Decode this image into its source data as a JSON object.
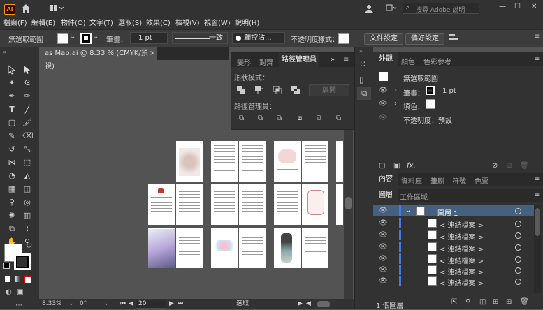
{
  "app": {
    "logo": "Ai",
    "accent": "#ff9a00"
  },
  "search": {
    "placeholder": "搜尋 Adobe 說明"
  },
  "menu": [
    "檔案(F)",
    "編輯(E)",
    "物件(O)",
    "文字(T)",
    "選取(S)",
    "效果(C)",
    "檢視(V)",
    "視窗(W)",
    "說明(H)"
  ],
  "control": {
    "selection": "無選取範圍",
    "stroke_label": "筆畫：",
    "stroke_value": "1 pt",
    "line_style": "一致",
    "brush": "觸控沾...",
    "opacity_label": "不透明度",
    "style_label": "樣式：",
    "doc_setup": "文件設定",
    "preferences": "偏好設定"
  },
  "doc": {
    "tab_title": "as Map.ai @ 8.33 % (CMYK/預視)",
    "close": "×"
  },
  "pathfinder": {
    "tabs": [
      "變形",
      "對齊",
      "路徑管理員"
    ],
    "shape_modes": "形狀模式：",
    "expand": "展開",
    "pathfinders": "路徑管理員："
  },
  "appearance": {
    "tabs": [
      "外觀",
      "顏色",
      "色彩參考"
    ],
    "no_selection": "無選取範圍",
    "stroke_label": "筆畫：",
    "stroke_value": "1 pt",
    "fill_label": "填色：",
    "opacity": "不透明度：預設",
    "fx": "fx."
  },
  "layers": {
    "tabs_top": [
      "內容",
      "資料庫",
      "筆刷",
      "符號",
      "色票"
    ],
    "tabs": [
      "圖層",
      "工作區域"
    ],
    "layer_name": "圖層 1",
    "items": [
      "< 連結檔案 >",
      "< 連結檔案 >",
      "< 連結檔案 >",
      "< 連結檔案 >",
      "< 連結檔案 >",
      "< 連結檔案 >"
    ],
    "count": "1 個圖層"
  },
  "status": {
    "zoom": "8.33%",
    "rotate": "0°",
    "page": "20",
    "mode": "選取"
  }
}
